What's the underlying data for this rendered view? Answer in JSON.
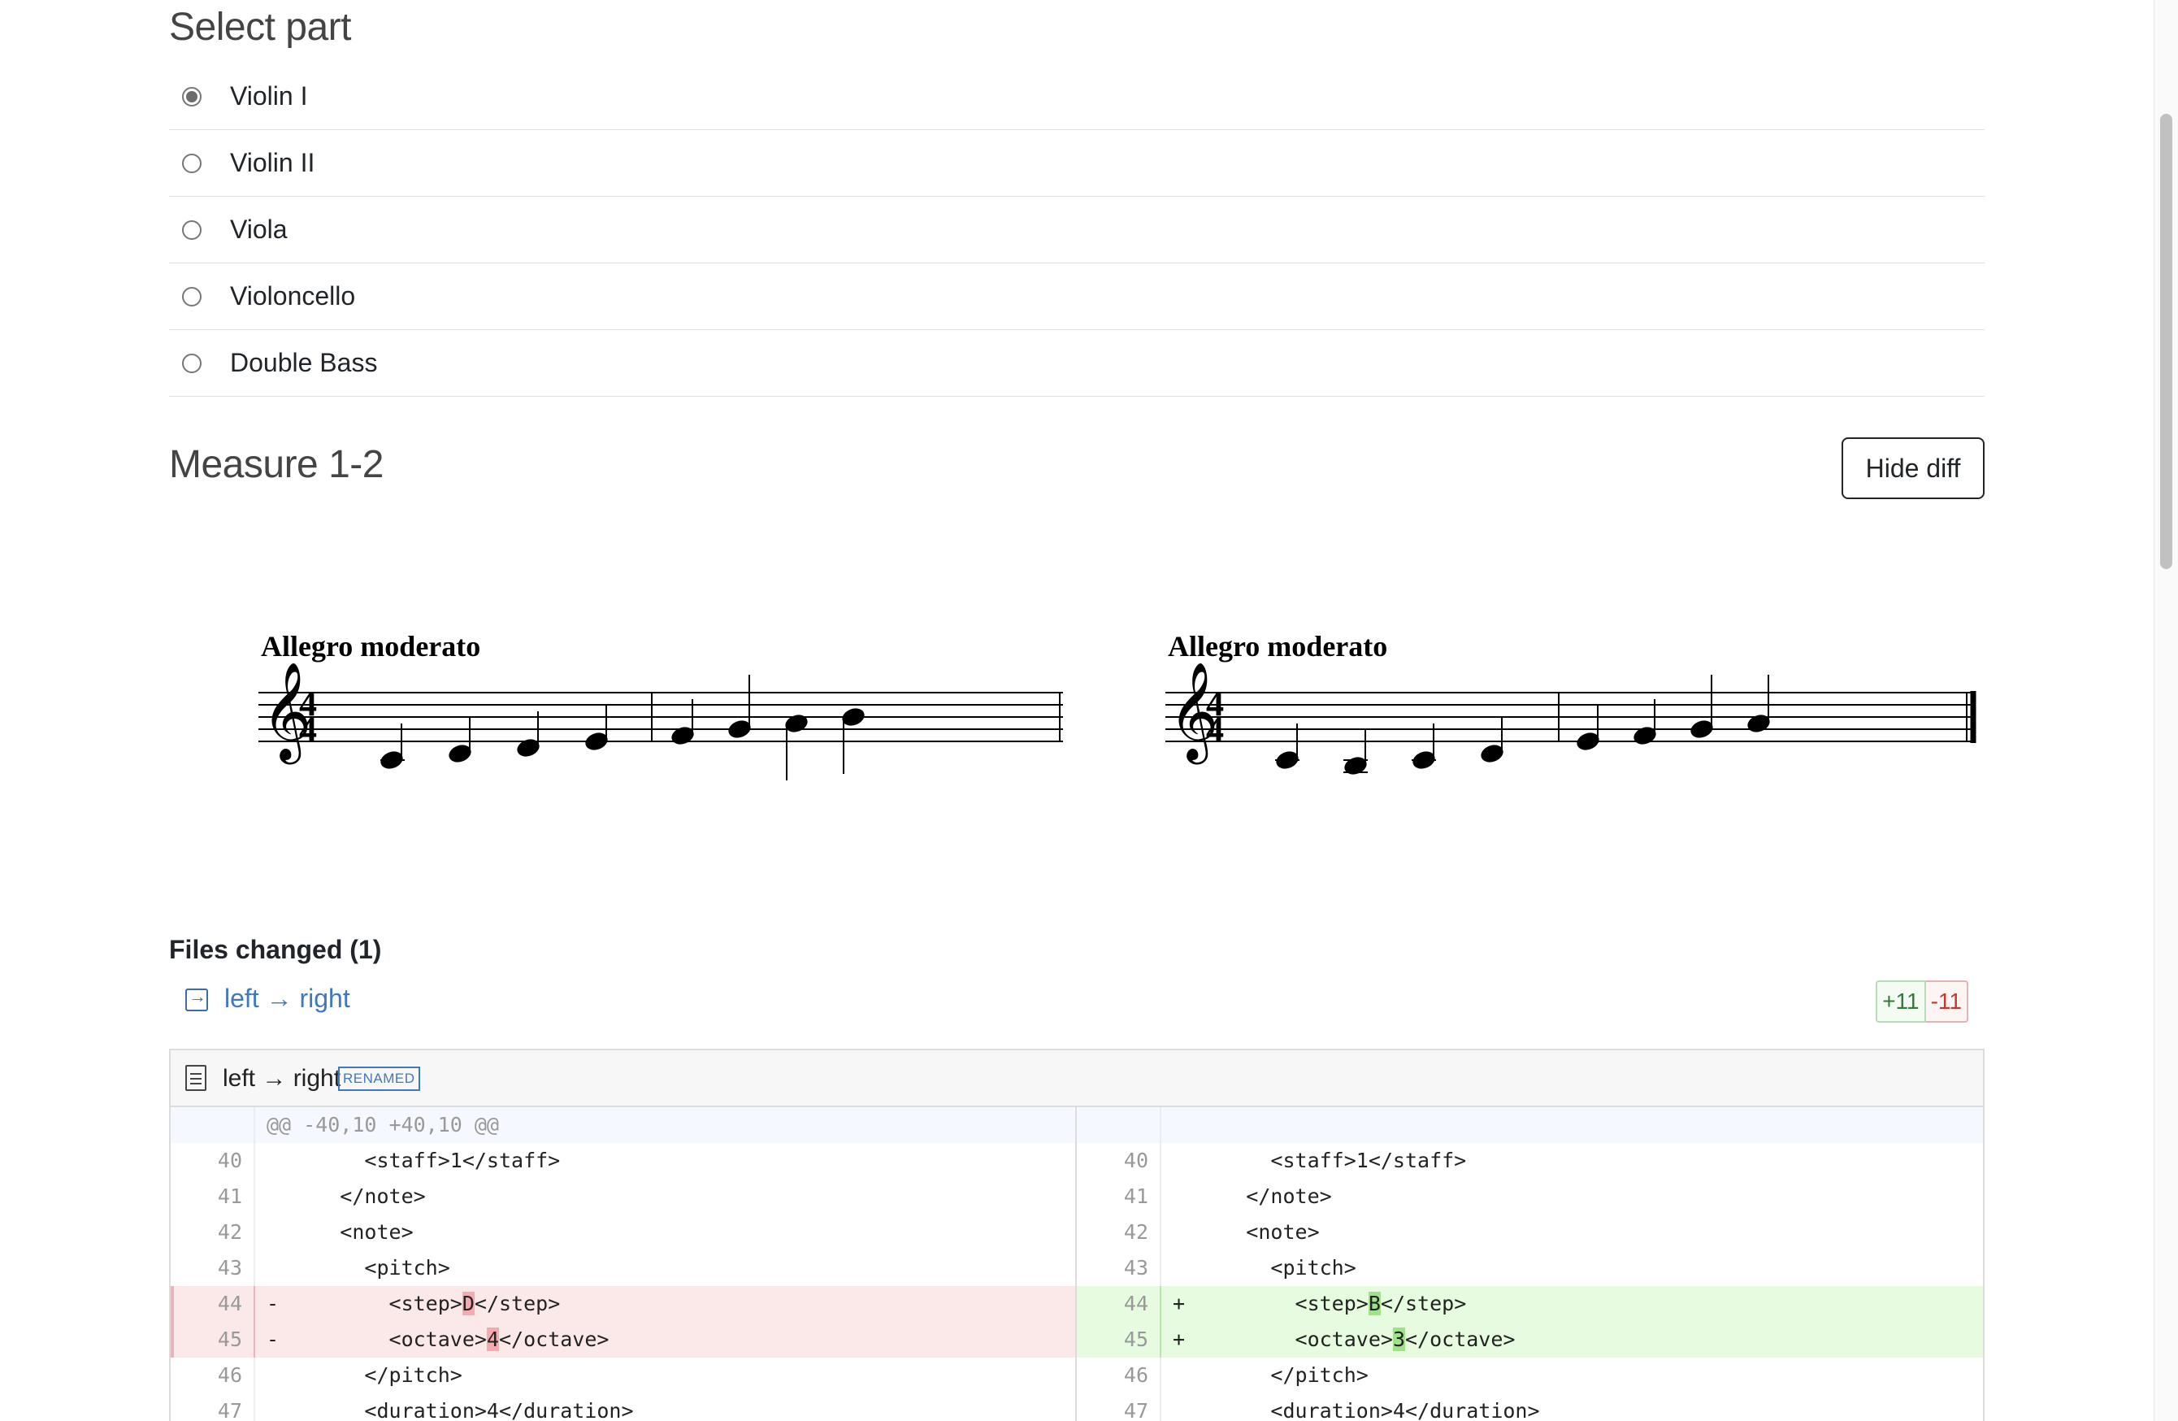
{
  "parts": {
    "title": "Select part",
    "items": [
      {
        "label": "Violin I",
        "selected": true
      },
      {
        "label": "Violin II",
        "selected": false
      },
      {
        "label": "Viola",
        "selected": false
      },
      {
        "label": "Violoncello",
        "selected": false
      },
      {
        "label": "Double Bass",
        "selected": false
      }
    ]
  },
  "measure": {
    "title": "Measure 1-2",
    "hide_diff_label": "Hide diff"
  },
  "scores": {
    "left": {
      "tempo": "Allegro moderato",
      "time_sig_top": "4",
      "time_sig_bottom": "4"
    },
    "right": {
      "tempo": "Allegro moderato",
      "time_sig_top": "4",
      "time_sig_bottom": "4"
    }
  },
  "files": {
    "title": "Files changed (1)",
    "link_text": "left → right",
    "additions": "+11",
    "deletions": "-11",
    "diff_file_name": "left → right",
    "badge": "RENAMED",
    "hunk": "@@ -40,10 +40,10 @@",
    "left_rows": [
      {
        "num": "40",
        "code": "        <staff>1</staff>"
      },
      {
        "num": "41",
        "code": "      </note>"
      },
      {
        "num": "42",
        "code": "      <note>"
      },
      {
        "num": "43",
        "code": "        <pitch>"
      },
      {
        "num": "44",
        "prefix": "-",
        "pre": "          <step>",
        "hl": "D",
        "post": "</step>"
      },
      {
        "num": "45",
        "prefix": "-",
        "pre": "          <octave>",
        "hl": "4",
        "post": "</octave>"
      },
      {
        "num": "46",
        "code": "        </pitch>"
      },
      {
        "num": "47",
        "code": "        <duration>4</duration>"
      }
    ],
    "right_rows": [
      {
        "num": "40",
        "code": "        <staff>1</staff>"
      },
      {
        "num": "41",
        "code": "      </note>"
      },
      {
        "num": "42",
        "code": "      <note>"
      },
      {
        "num": "43",
        "code": "        <pitch>"
      },
      {
        "num": "44",
        "prefix": "+",
        "pre": "          <step>",
        "hl": "B",
        "post": "</step>"
      },
      {
        "num": "45",
        "prefix": "+",
        "pre": "          <octave>",
        "hl": "3",
        "post": "</octave>"
      },
      {
        "num": "46",
        "code": "        </pitch>"
      },
      {
        "num": "47",
        "code": "        <duration>4</duration>"
      }
    ]
  }
}
